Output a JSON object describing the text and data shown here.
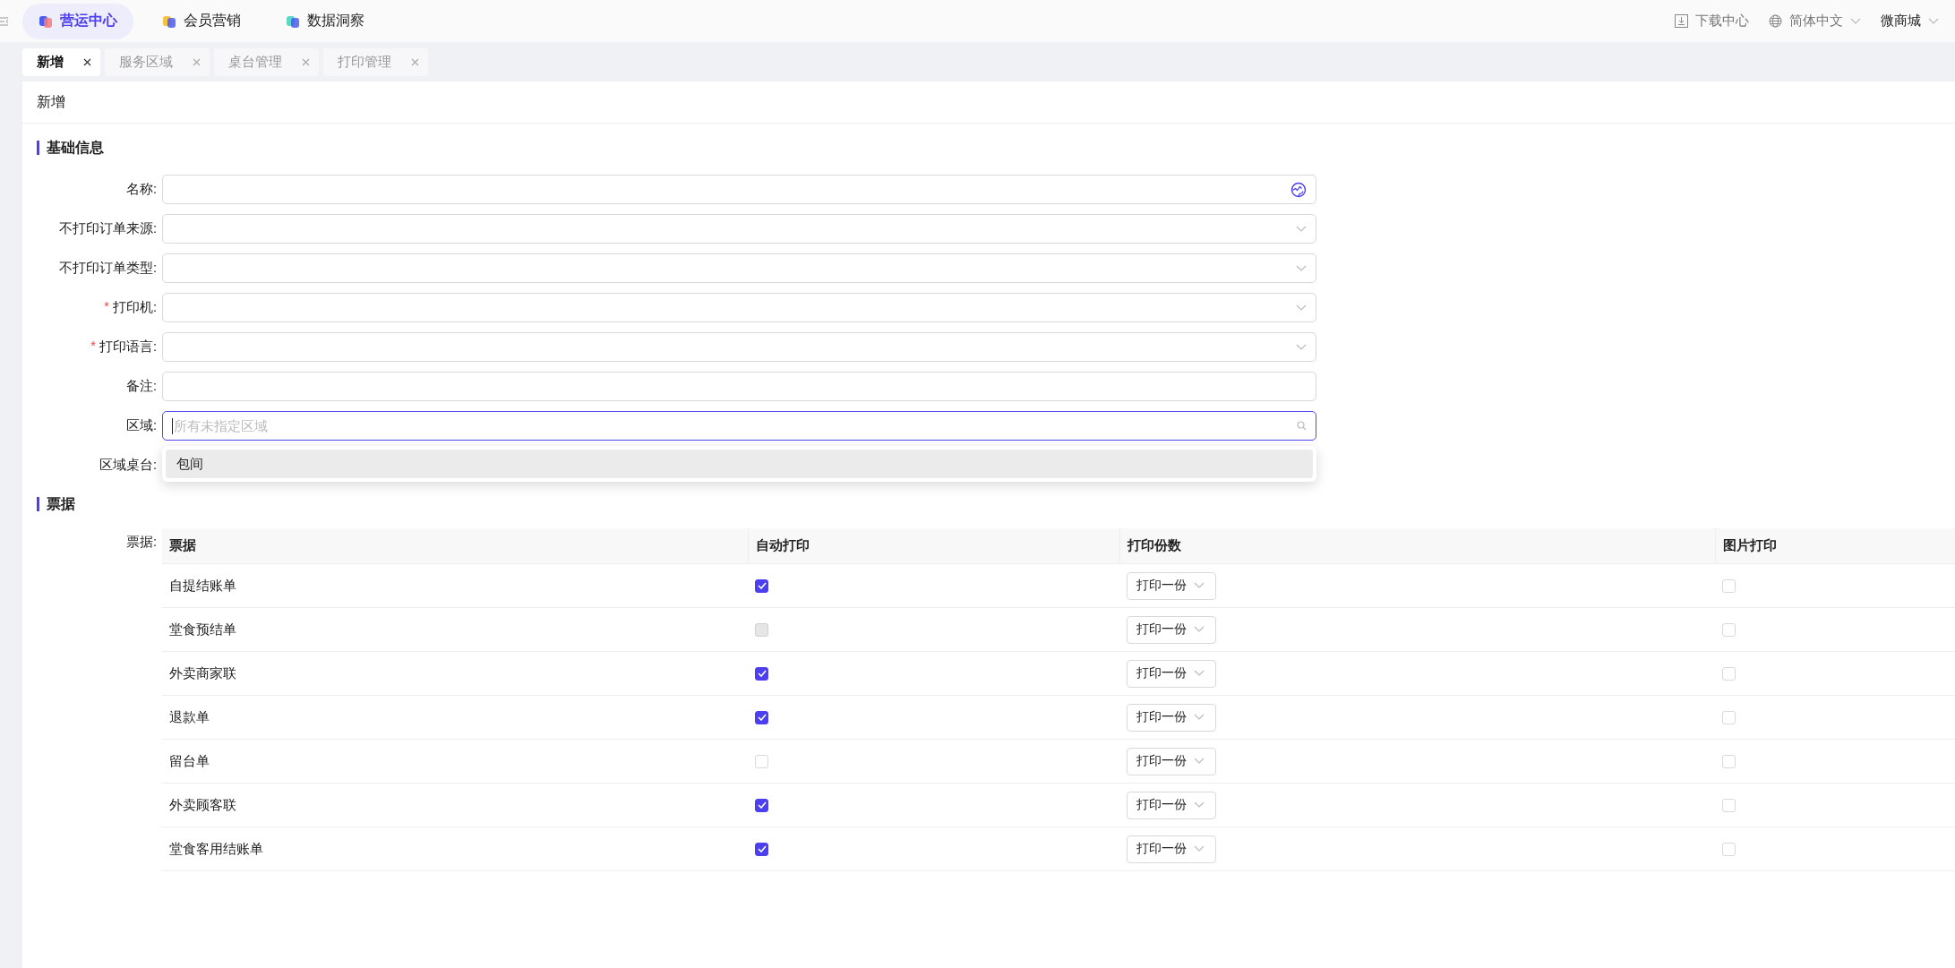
{
  "top_nav": {
    "items": [
      {
        "label": "营运中心",
        "selected": true
      },
      {
        "label": "会员营销",
        "selected": false
      },
      {
        "label": "数据洞察",
        "selected": false
      }
    ],
    "actions": [
      {
        "kind": "download",
        "label": "下载中心"
      },
      {
        "kind": "language",
        "label": "简体中文"
      },
      {
        "kind": "account",
        "label": "微商城"
      }
    ]
  },
  "tabs": [
    {
      "label": "新增",
      "selected": true
    },
    {
      "label": "服务区域",
      "selected": false
    },
    {
      "label": "桌台管理",
      "selected": false
    },
    {
      "label": "打印管理",
      "selected": false
    }
  ],
  "page_title": "新增",
  "basic_info": {
    "title": "基础信息",
    "fields": [
      {
        "label": "名称:",
        "kind": "translate"
      },
      {
        "label": "不打印订单来源:",
        "kind": "select"
      },
      {
        "label": "不打印订单类型:",
        "kind": "select"
      },
      {
        "label": "打印机:",
        "kind": "select",
        "required_mark": "*"
      },
      {
        "label": "打印语言:",
        "kind": "select",
        "required_mark": "*"
      },
      {
        "label": "备注:",
        "kind": "text"
      },
      {
        "label": "区域:",
        "kind": "search",
        "focused": true,
        "placeholder": "所有未指定区域",
        "options": [
          {
            "label": "包间",
            "highlighted": true
          }
        ]
      },
      {
        "label": "区域桌台:",
        "kind": "short"
      }
    ]
  },
  "receipts": {
    "title": "票据",
    "label": "票据:",
    "columns": [
      "票据",
      "自动打印",
      "打印份数",
      "图片打印"
    ],
    "rows": [
      {
        "name": "自提结账单",
        "auto_print": {
          "checked": true,
          "disabled": false
        },
        "copies": "打印一份",
        "image_print": {
          "checked": false
        }
      },
      {
        "name": "堂食预结单",
        "auto_print": {
          "checked": false,
          "disabled": true
        },
        "copies": "打印一份",
        "image_print": {
          "checked": false
        }
      },
      {
        "name": "外卖商家联",
        "auto_print": {
          "checked": true,
          "disabled": false
        },
        "copies": "打印一份",
        "image_print": {
          "checked": false
        }
      },
      {
        "name": "退款单",
        "auto_print": {
          "checked": true,
          "disabled": false
        },
        "copies": "打印一份",
        "image_print": {
          "checked": false
        }
      },
      {
        "name": "留台单",
        "auto_print": {
          "checked": false,
          "disabled": false
        },
        "copies": "打印一份",
        "image_print": {
          "checked": false
        }
      },
      {
        "name": "外卖顾客联",
        "auto_print": {
          "checked": true,
          "disabled": false
        },
        "copies": "打印一份",
        "image_print": {
          "checked": false
        }
      },
      {
        "name": "堂食客用结账单",
        "auto_print": {
          "checked": true,
          "disabled": false
        },
        "copies": "打印一份",
        "image_print": {
          "checked": false
        }
      }
    ]
  }
}
